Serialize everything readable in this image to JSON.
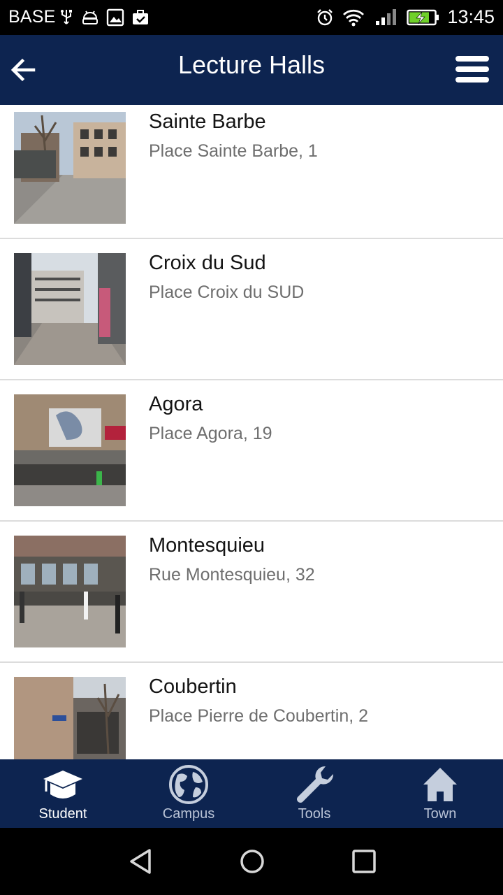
{
  "status_bar": {
    "carrier": "BASE",
    "time": "13:45",
    "icons": [
      "usb-icon",
      "android-debug-icon",
      "image-icon",
      "briefcase-check-icon",
      "alarm-icon",
      "wifi-icon",
      "signal-icon",
      "battery-charging-icon"
    ]
  },
  "app_bar": {
    "title": "Lecture Halls",
    "back_icon": "arrow-back-icon",
    "menu_icon": "hamburger-menu-icon"
  },
  "halls": [
    {
      "name": "Sainte Barbe",
      "address": "Place Sainte Barbe, 1"
    },
    {
      "name": "Croix du Sud",
      "address": "Place Croix du SUD"
    },
    {
      "name": "Agora",
      "address": "Place Agora, 19"
    },
    {
      "name": "Montesquieu",
      "address": "Rue Montesquieu, 32"
    },
    {
      "name": "Coubertin",
      "address": "Place Pierre de Coubertin, 2"
    }
  ],
  "bottom_nav": {
    "tabs": [
      {
        "label": "Student",
        "icon": "graduation-cap-icon",
        "active": true
      },
      {
        "label": "Campus",
        "icon": "globe-icon",
        "active": false
      },
      {
        "label": "Tools",
        "icon": "wrench-icon",
        "active": false
      },
      {
        "label": "Town",
        "icon": "home-icon",
        "active": false
      }
    ]
  },
  "colors": {
    "primary": "#0d2450",
    "text_primary": "#141414",
    "text_secondary": "#6e6e6e",
    "divider": "#dcdcdc"
  }
}
